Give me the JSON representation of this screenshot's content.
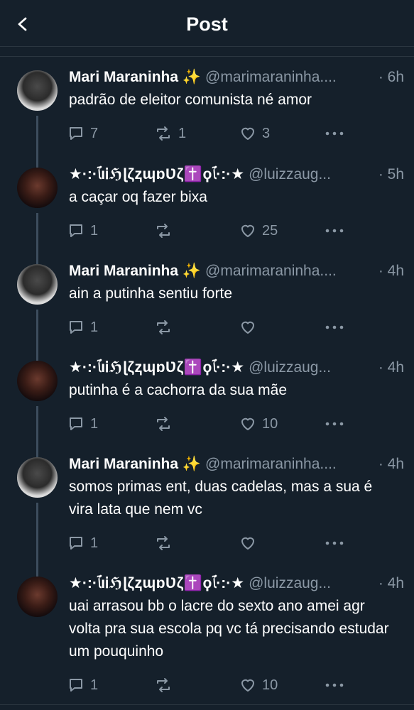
{
  "header": {
    "title": "Post"
  },
  "tweets": [
    {
      "author": "mari",
      "name": "Mari Maraninha ✨",
      "handle": "@marimaraninha....",
      "time": "· 6h",
      "text": "padrão de eleitor comunista né amor",
      "replies": "7",
      "retweets": "1",
      "likes": "3"
    },
    {
      "author": "luiz",
      "name": "★·:·ﭑıᎥℌɭζⱬɰɒƲζ✝️ϙﭑ·:·★",
      "handle": "@luizzaug...",
      "time": "· 5h",
      "text": "a caçar oq fazer bixa",
      "replies": "1",
      "retweets": "",
      "likes": "25"
    },
    {
      "author": "mari",
      "name": "Mari Maraninha ✨",
      "handle": "@marimaraninha....",
      "time": "· 4h",
      "text": "ain a putinha sentiu forte",
      "replies": "1",
      "retweets": "",
      "likes": ""
    },
    {
      "author": "luiz",
      "name": "★·:·ﭑıᎥℌɭζⱬɰɒƲζ✝️ϙﭑ·:·★",
      "handle": "@luizzaug...",
      "time": "· 4h",
      "text": "putinha é a cachorra da sua mãe",
      "replies": "1",
      "retweets": "",
      "likes": "10"
    },
    {
      "author": "mari",
      "name": "Mari Maraninha ✨",
      "handle": "@marimaraninha....",
      "time": "· 4h",
      "text": "somos primas ent, duas cadelas, mas a sua é vira lata que nem vc",
      "replies": "1",
      "retweets": "",
      "likes": ""
    },
    {
      "author": "luiz",
      "name": "★·:·ﭑıᎥℌɭζⱬɰɒƲζ✝️ϙﭑ·:·★",
      "handle": "@luizzaug...",
      "time": "· 4h",
      "text": "uai arrasou bb o lacre do sexto ano amei agr volta pra sua escola pq vc tá precisando estudar um pouquinho",
      "replies": "1",
      "retweets": "",
      "likes": "10"
    }
  ],
  "icons": {
    "back": "chevron-left-icon",
    "reply": "reply-icon",
    "retweet": "retweet-icon",
    "like": "heart-icon",
    "more": "more-icon"
  },
  "colors": {
    "background": "#15202b",
    "secondary_text": "#8b98a5",
    "thread_line": "#3d4d5d",
    "divider": "#2b3640"
  }
}
